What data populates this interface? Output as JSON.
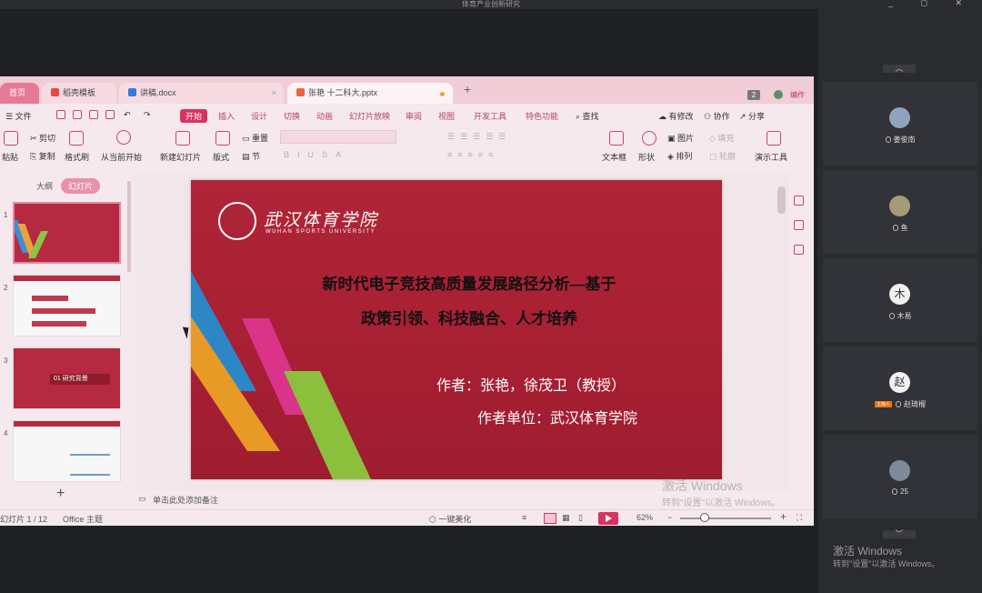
{
  "meeting": {
    "title": "体育产业创新研究",
    "win_ctrls": "_ ◻ ✕"
  },
  "tabs": {
    "home": "首页",
    "templates": "稻壳模板",
    "doc": "讲稿.docx",
    "ppt": "张艳 十二科大.pptx",
    "doc_close": "×",
    "add": "+"
  },
  "titlebar_right": {
    "badge": "2",
    "user": "编作"
  },
  "menu": {
    "file": "文件",
    "start": "开始",
    "insert": "插入",
    "design": "设计",
    "transition": "切换",
    "animation": "动画",
    "slideshow": "幻灯片放映",
    "review": "审阅",
    "view": "视图",
    "dev": "开发工具",
    "special": "特色功能",
    "search": "查找",
    "changes": "有修改",
    "collab": "协作",
    "share": "分享"
  },
  "ribbon": {
    "paste": "粘贴",
    "cut": "剪切",
    "copy": "复制",
    "format_painter": "格式刷",
    "from_current": "从当前开始",
    "new_slide": "新建幻灯片",
    "layout": "版式",
    "reset": "重置",
    "section": "节",
    "textbox": "文本框",
    "shape": "形状",
    "picture": "图片",
    "arrange": "排列",
    "fill": "填充",
    "outline": "轮廓",
    "present_tools": "演示工具"
  },
  "left_panel": {
    "outline": "大纲",
    "slides": "幻灯片",
    "nums": [
      "1",
      "2",
      "3",
      "4"
    ],
    "thumb3_text": "01 研究背景"
  },
  "slide": {
    "logo_text": "武汉体育学院",
    "logo_sub": "WUHAN SPORTS UNIVERSITY",
    "title_line1": "新时代电子竞技高质量发展路径分析—基于",
    "title_line2": "政策引领、科技融合、人才培养",
    "author": "作者：张艳，徐茂卫（教授）",
    "unit": "作者单位：武汉体育学院"
  },
  "notes_placeholder": "单击此处添加备注",
  "status": {
    "slide_count": "幻灯片 1 / 12",
    "theme": "Office 主题",
    "beautify": "一键美化",
    "zoom": "62%",
    "zoom_level": 0.27
  },
  "watermark": {
    "line1": "激活 Windows",
    "line2": "转到\"设置\"以激活 Windows。"
  },
  "participants": [
    {
      "name": "姜俊南",
      "avatar": ""
    },
    {
      "name": "鱼",
      "avatar": ""
    },
    {
      "name": "木易",
      "avatar": "木"
    },
    {
      "name": "赵琦榴",
      "avatar": "赵",
      "tag": "主持人"
    },
    {
      "name": "25",
      "avatar": ""
    }
  ],
  "chevrons": {
    "up": "︿",
    "down": "﹀"
  },
  "colors": {
    "accent": "#d8335e",
    "slide_bg": "#ad2236",
    "panel_bg": "#2a2b2f"
  }
}
